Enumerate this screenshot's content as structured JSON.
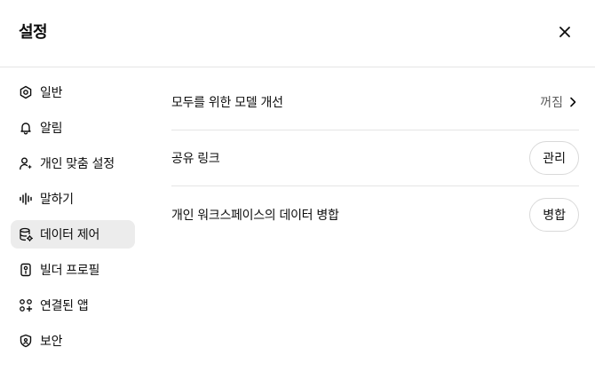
{
  "dialog": {
    "title": "설정"
  },
  "sidebar": {
    "items": [
      {
        "label": "일반",
        "icon": "gear-icon"
      },
      {
        "label": "알림",
        "icon": "bell-icon"
      },
      {
        "label": "개인 맞춤 설정",
        "icon": "person-sparkle-icon"
      },
      {
        "label": "말하기",
        "icon": "waveform-icon"
      },
      {
        "label": "데이터 제어",
        "icon": "database-gear-icon",
        "active": true
      },
      {
        "label": "빌더 프로필",
        "icon": "id-card-icon"
      },
      {
        "label": "연결된 앱",
        "icon": "apps-grid-icon"
      },
      {
        "label": "보안",
        "icon": "shield-icon"
      }
    ]
  },
  "main": {
    "rows": [
      {
        "label": "모두를 위한 모델 개선",
        "status": "꺼짐"
      },
      {
        "label": "공유 링크",
        "button": "관리"
      },
      {
        "label": "개인 워크스페이스의 데이터 병합",
        "button": "병합"
      }
    ]
  }
}
